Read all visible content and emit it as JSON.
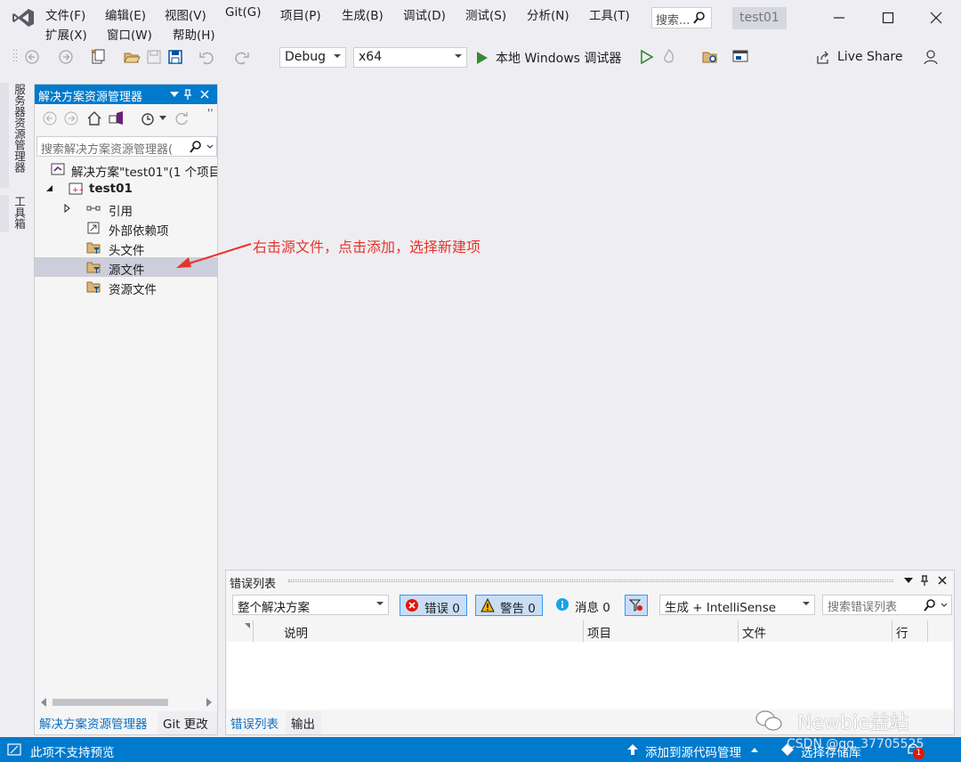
{
  "menu": {
    "row1": [
      "文件(F)",
      "编辑(E)",
      "视图(V)",
      "Git(G)",
      "项目(P)",
      "生成(B)",
      "调试(D)",
      "测试(S)",
      "分析(N)",
      "工具(T)"
    ],
    "row2": [
      "扩展(X)",
      "窗口(W)",
      "帮助(H)"
    ],
    "search_placeholder": "搜索...",
    "project_badge": "test01"
  },
  "toolbar": {
    "config": "Debug",
    "platform": "x64",
    "run_label": "本地 Windows 调试器",
    "live_share": "Live Share"
  },
  "rail": {
    "tab1": "服务器资源管理器",
    "tab2": "工具箱"
  },
  "solution_explorer": {
    "title": "解决方案资源管理器",
    "search_placeholder": "搜索解决方案资源管理器(",
    "tree": [
      {
        "label": "解决方案\"test01\"(1 个项目",
        "icon": "solution-icon",
        "level": 0
      },
      {
        "label": "test01",
        "icon": "cpp-project-icon",
        "level": 1,
        "bold": true
      },
      {
        "label": "引用",
        "icon": "references-icon",
        "level": 2
      },
      {
        "label": "外部依赖项",
        "icon": "external-deps-icon",
        "level": 2
      },
      {
        "label": "头文件",
        "icon": "folder-filter-icon",
        "level": 2
      },
      {
        "label": "源文件",
        "icon": "folder-filter-icon",
        "level": 2,
        "selected": true
      },
      {
        "label": "资源文件",
        "icon": "folder-filter-icon",
        "level": 2
      }
    ],
    "tabs": [
      "解决方案资源管理器",
      "Git 更改"
    ]
  },
  "annotation": "右击源文件，点击添加，选择新建项",
  "error_list": {
    "title": "错误列表",
    "scope": "整个解决方案",
    "errors_label": "错误 0",
    "warnings_label": "警告 0",
    "messages_label": "消息 0",
    "build_filter": "生成 + IntelliSense",
    "search_placeholder": "搜索错误列表",
    "columns": [
      "说明",
      "项目",
      "文件",
      "行"
    ],
    "tabs": [
      "错误列表",
      "输出"
    ]
  },
  "status": {
    "left": "此项不支持预览",
    "source_control": "添加到源代码管理",
    "repo": "选择存储库",
    "notifications": "1"
  },
  "watermark": "Newbie益站",
  "credit": "CSDN @qq_37705525",
  "colors": {
    "accent": "#007acc",
    "annotation": "#e8332a",
    "selection": "#cccedb",
    "background": "#eeeef2"
  }
}
